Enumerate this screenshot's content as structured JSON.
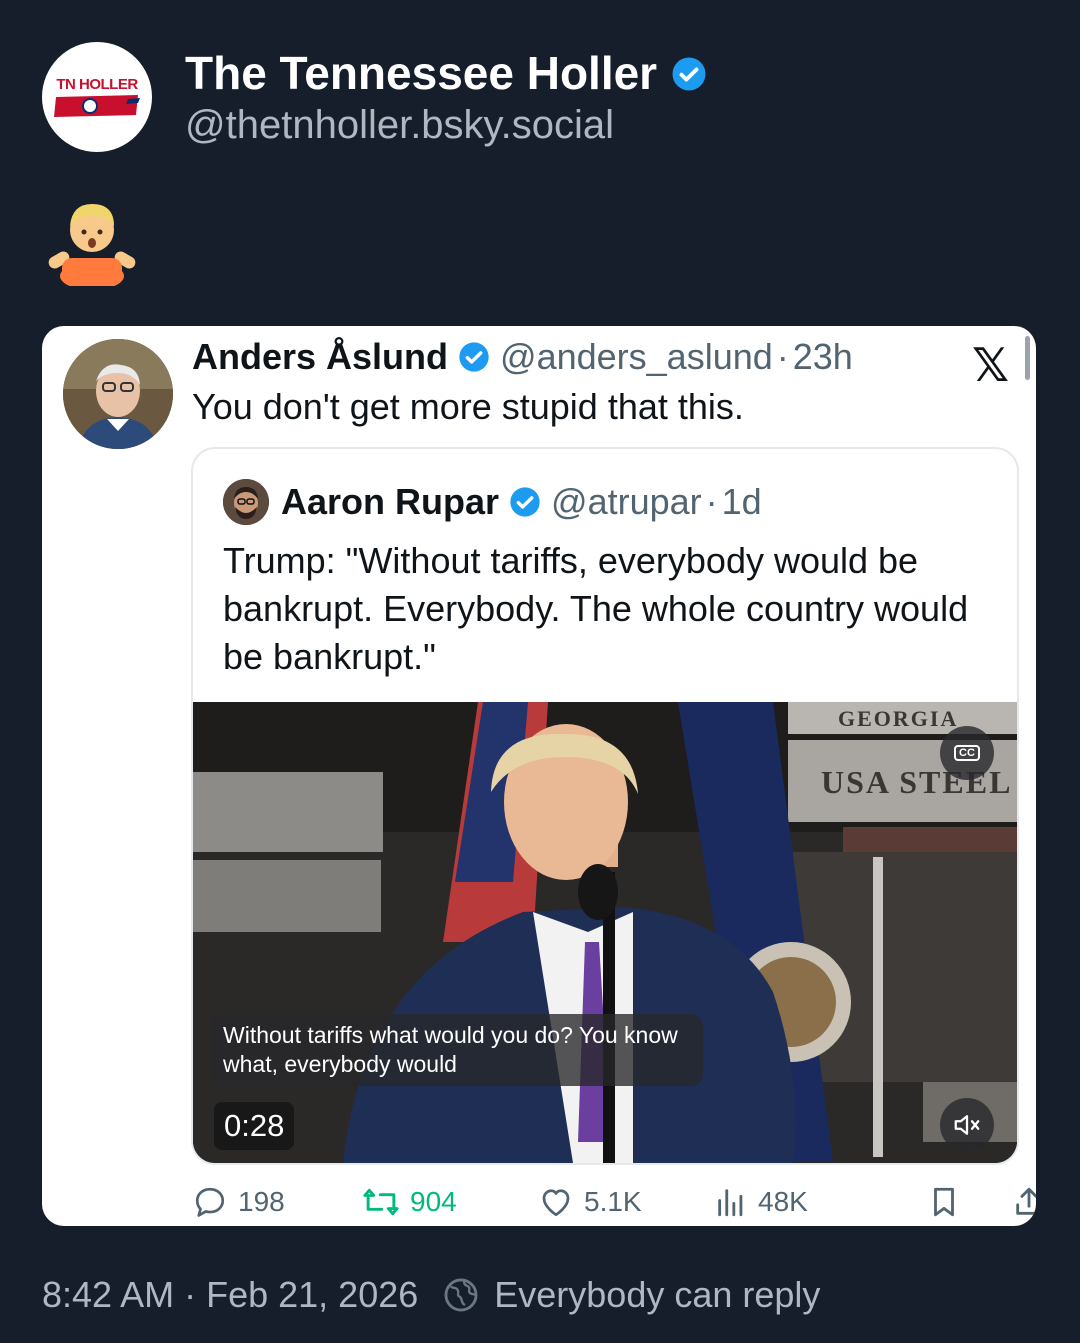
{
  "post": {
    "author_name": "The Tennessee Holler",
    "author_handle": "@thetnholler.bsky.social",
    "avatar_logo_text": "TN HOLLER",
    "emoji": "person-shrugging",
    "timestamp": "8:42 AM",
    "date": "Feb 21, 2026",
    "reply_setting": "Everybody can reply"
  },
  "embed": {
    "author_name": "Anders Åslund",
    "author_handle": "@anders_aslund",
    "time": "23h",
    "text": "You don't get more stupid that this.",
    "platform_icon": "x-logo",
    "quoted": {
      "author_name": "Aaron Rupar",
      "author_handle": "@atrupar",
      "time": "1d",
      "text": "Trump: \"Without tariffs, everybody would be bankrupt. Everybody. The whole country would be bankrupt.\"",
      "video": {
        "caption": "Without tariffs what would you do? You know what, everybody would",
        "duration": "0:28",
        "sign_1": "GEORGIA",
        "sign_2": "USA STEEL"
      }
    },
    "stats": {
      "replies": "198",
      "reposts": "904",
      "likes": "5.1K",
      "views": "48K"
    }
  },
  "colors": {
    "background": "#161e2b",
    "verified": "#1d9bf0",
    "repost": "#00ba7c"
  }
}
